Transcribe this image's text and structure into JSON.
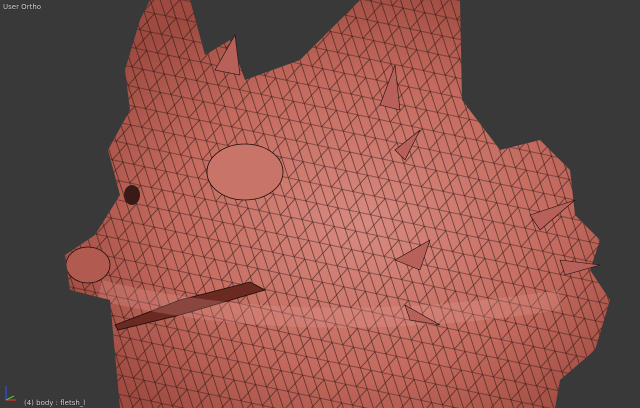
{
  "viewport": {
    "view_name": "User Ortho",
    "object_info": "(4) body : fletsh_l",
    "background_color": "#393939",
    "mesh_color": "#c46a5e",
    "wire_color": "#1a0d0b"
  },
  "axes": {
    "x_color": "#e03030",
    "y_color": "#60c030",
    "z_color": "#3050e0"
  }
}
